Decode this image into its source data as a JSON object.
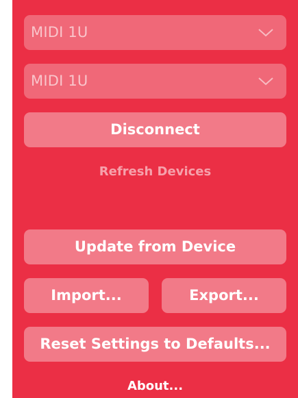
{
  "device_selects": {
    "input_value": "MIDI 1U",
    "output_value": "MIDI 1U",
    "chevron_icon": "chevron-down-icon"
  },
  "actions": {
    "disconnect": "Disconnect",
    "refresh_devices": "Refresh Devices",
    "update_from_device": "Update from Device",
    "import": "Import...",
    "export": "Export...",
    "reset_defaults": "Reset Settings to Defaults...",
    "about": "About..."
  },
  "colors": {
    "panel_background": "#eb2f45",
    "button_text": "#ffffff"
  }
}
